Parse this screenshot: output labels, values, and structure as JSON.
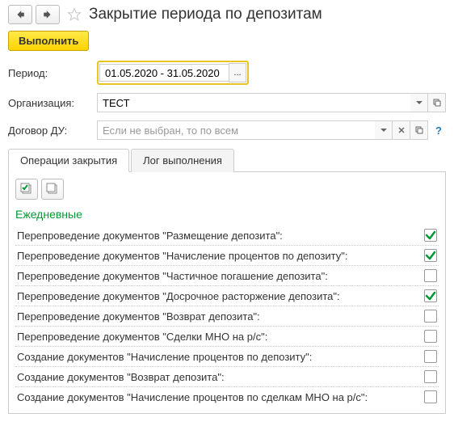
{
  "header": {
    "title": "Закрытие периода по депозитам"
  },
  "toolbar": {
    "execute_label": "Выполнить"
  },
  "fields": {
    "period_label": "Период:",
    "period_value": "01.05.2020 - 31.05.2020",
    "org_label": "Организация:",
    "org_value": "ТЕСТ",
    "contract_label": "Договор ДУ:",
    "contract_value": "",
    "contract_placeholder": "Если не выбран, то по всем"
  },
  "tabs": [
    {
      "label": "Операции закрытия",
      "active": true
    },
    {
      "label": "Лог выполнения",
      "active": false
    }
  ],
  "section_title": "Ежедневные",
  "items": [
    {
      "label": "Перепроведение документов \"Размещение депозита\":",
      "checked": true
    },
    {
      "label": "Перепроведение документов \"Начисление процентов по депозиту\":",
      "checked": true
    },
    {
      "label": "Перепроведение документов \"Частичное погашение депозита\":",
      "checked": false
    },
    {
      "label": "Перепроведение документов \"Досрочное расторжение депозита\":",
      "checked": true
    },
    {
      "label": "Перепроведение документов \"Возврат депозита\":",
      "checked": false
    },
    {
      "label": "Перепроведение документов \"Сделки МНО на р/с\":",
      "checked": false
    },
    {
      "label": "Создание документов \"Начисление процентов по депозиту\":",
      "checked": false
    },
    {
      "label": "Создание документов \"Возврат депозита\":",
      "checked": false
    },
    {
      "label": "Создание документов \"Начисление процентов по сделкам МНО на р/с\":",
      "checked": false
    }
  ]
}
